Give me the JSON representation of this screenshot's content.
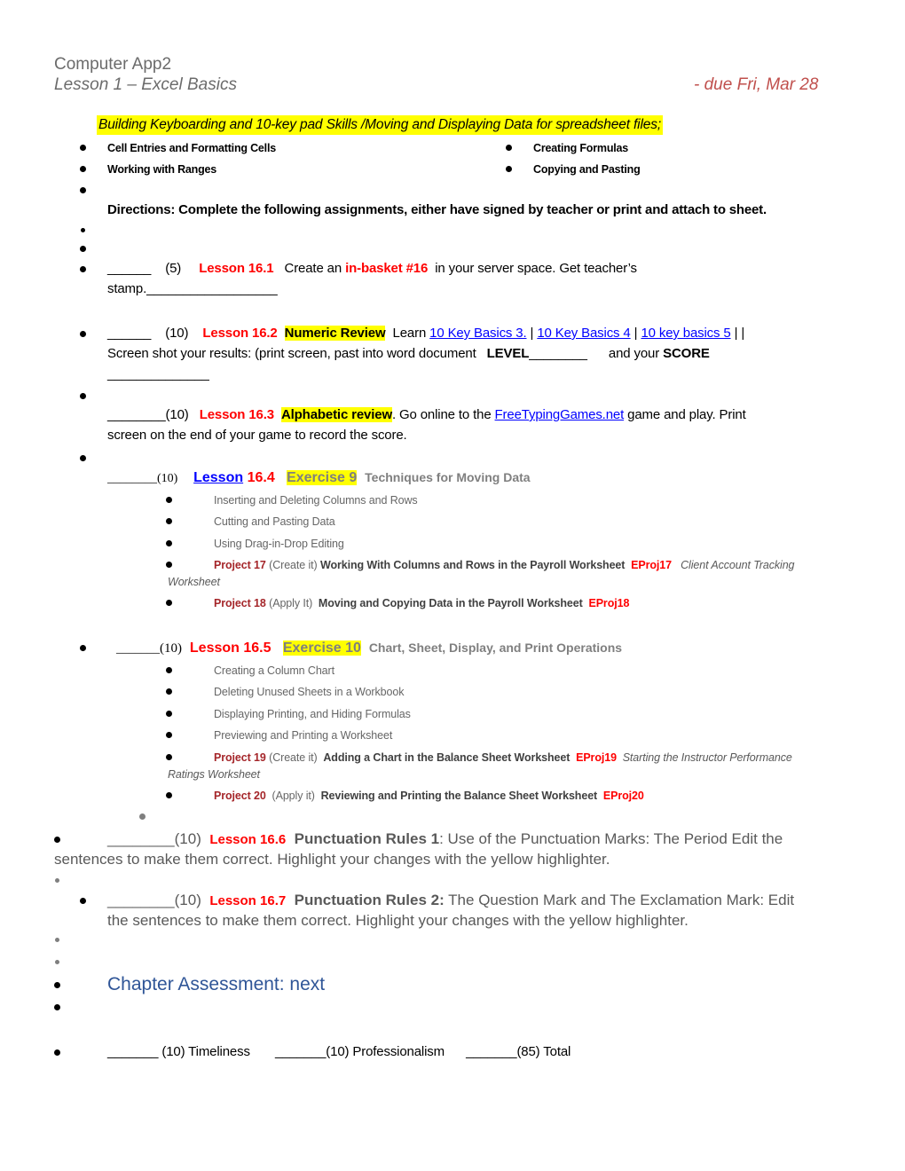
{
  "header": {
    "course": "Computer App2",
    "lesson": "Lesson 1 – Excel Basics",
    "due": "- due Fri, Mar 28"
  },
  "banner": "Building Keyboarding and 10-key pad Skills /Moving and Displaying Data for spreadsheet files;",
  "topics": {
    "left": [
      "Cell Entries and Formatting Cells",
      "Working with Ranges"
    ],
    "right": [
      "Creating Formulas",
      "Copying and Pasting"
    ]
  },
  "directions": "Directions:  Complete the following assignments, either have signed by teacher or print and attach to sheet.",
  "assignments": {
    "a161": {
      "blank": "______",
      "points": "(5)",
      "lesson": "Lesson 16.1",
      "text1": "Create an",
      "highlight": "in-basket #16",
      "text2": "in your server space.  Get teacher’s",
      "line2": "stamp.__________________"
    },
    "a162": {
      "blank": "______",
      "points": "(10)",
      "lesson": "Lesson 16.2",
      "tag": "Numeric Review",
      "learn": "Learn",
      "links": [
        "10 Key Basics 3.",
        "10 Key Basics 4",
        "10 key basics 5"
      ],
      "sep": "|",
      "trail": "| |",
      "line2a": "Screen shot your results:   (print screen, past into word document",
      "level": "LEVEL",
      "level_blank": "________",
      "and_your": "and your",
      "score": "SCORE",
      "line3": "______________"
    },
    "a163": {
      "blank": "________",
      "points": "(10)",
      "lesson": "Lesson 16.3",
      "tag": "Alphabetic review",
      "text1": ".  Go online to the",
      "link": "FreeTypingGames.net",
      "text2": "game and play.  Print",
      "line2": "screen on the end of your game to record the score."
    },
    "a164": {
      "blank": "________",
      "points": "(10)",
      "lesson_link": "Lesson",
      "number": "16.4",
      "exercise": "Exercise 9",
      "desc": "Techniques for Moving Data",
      "items": [
        "Inserting and Deleting Columns and Rows",
        "Cutting and Pasting Data",
        "Using Drag-in-Drop Editing"
      ],
      "p17": {
        "label": "Project 17",
        "type": "(Create it)",
        "title": "Working With Columns and Rows in the Payroll Worksheet",
        "file": "EProj17",
        "italic1": "Client Account Tracking",
        "italic2": "Worksheet"
      },
      "p18": {
        "label": "Project 18",
        "type": "(Apply It)",
        "title": "Moving and Copying Data in the Payroll Worksheet",
        "file": "EProj18"
      }
    },
    "a165": {
      "blank": "_______",
      "points": "(10)",
      "lesson": "Lesson 16.5",
      "exercise": "Exercise 10",
      "desc": "Chart, Sheet, Display, and Print Operations",
      "items": [
        "Creating a Column Chart",
        "Deleting Unused Sheets in a Workbook",
        "Displaying Printing, and Hiding Formulas",
        "Previewing and Printing a Worksheet"
      ],
      "p19": {
        "label": "Project 19",
        "type": "(Create it)",
        "title": "Adding a Chart in the Balance Sheet Worksheet",
        "file": "EProj19",
        "italic1": "Starting the Instructor Performance",
        "italic2": "Ratings Worksheet"
      },
      "p20": {
        "label": "Project 20",
        "type": "(Apply it)",
        "title": "Reviewing and Printing the Balance Sheet Worksheet",
        "file": "EProj20"
      }
    },
    "a166": {
      "blank": "________",
      "points": "(10)",
      "lesson": "Lesson 16.6",
      "title": "Punctuation Rules 1",
      "text1": ":  Use of the Punctuation Marks:  The Period  Edit the",
      "line2": "sentences to make them correct.  Highlight your changes with the yellow highlighter."
    },
    "a167": {
      "blank": "________",
      "points": "(10)",
      "lesson": "Lesson 16.7",
      "title": "Punctuation Rules 2:",
      "text1": "The Question Mark and The Exclamation Mark:  Edit",
      "line2": "the sentences to make them correct.  Highlight your changes with the yellow highlighter."
    }
  },
  "chapter_assessment": "Chapter Assessment:  next",
  "totals": {
    "timeliness": "_______ (10)  Timeliness",
    "professionalism": "_______(10)   Professionalism",
    "total": "_______(85)  Total"
  }
}
